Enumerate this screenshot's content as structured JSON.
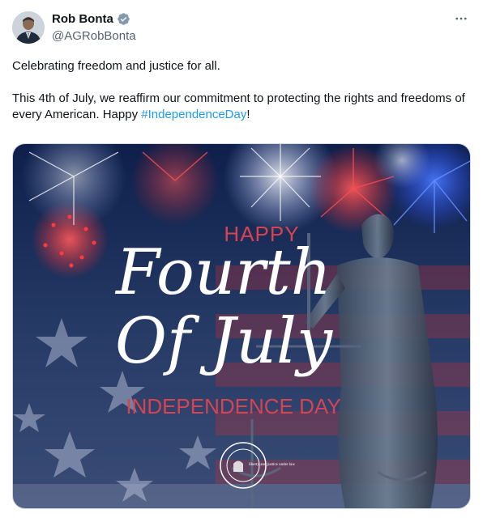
{
  "author": {
    "name": "Rob Bonta",
    "handle": "@AGRobBonta",
    "verified": true
  },
  "tweet": {
    "line1": "Celebrating freedom and justice for all.",
    "line2_before": "This 4th of July, we reaffirm our commitment to protecting the rights and freedoms of every American. Happy ",
    "hashtag": "#IndependenceDay",
    "line2_after": "!"
  },
  "media": {
    "happy": "HAPPY",
    "title_line1": "Fourth",
    "title_line2": "Of July",
    "subtitle": "INDEPENDENCE DAY",
    "seal_text": "liberty and justice under law"
  },
  "icons": {
    "more": "more-horizontal-icon",
    "verified": "verified-badge-icon"
  },
  "colors": {
    "hashtag": "#1d9bf0",
    "accent_red": "#d9434f",
    "verified": "#829aab"
  }
}
